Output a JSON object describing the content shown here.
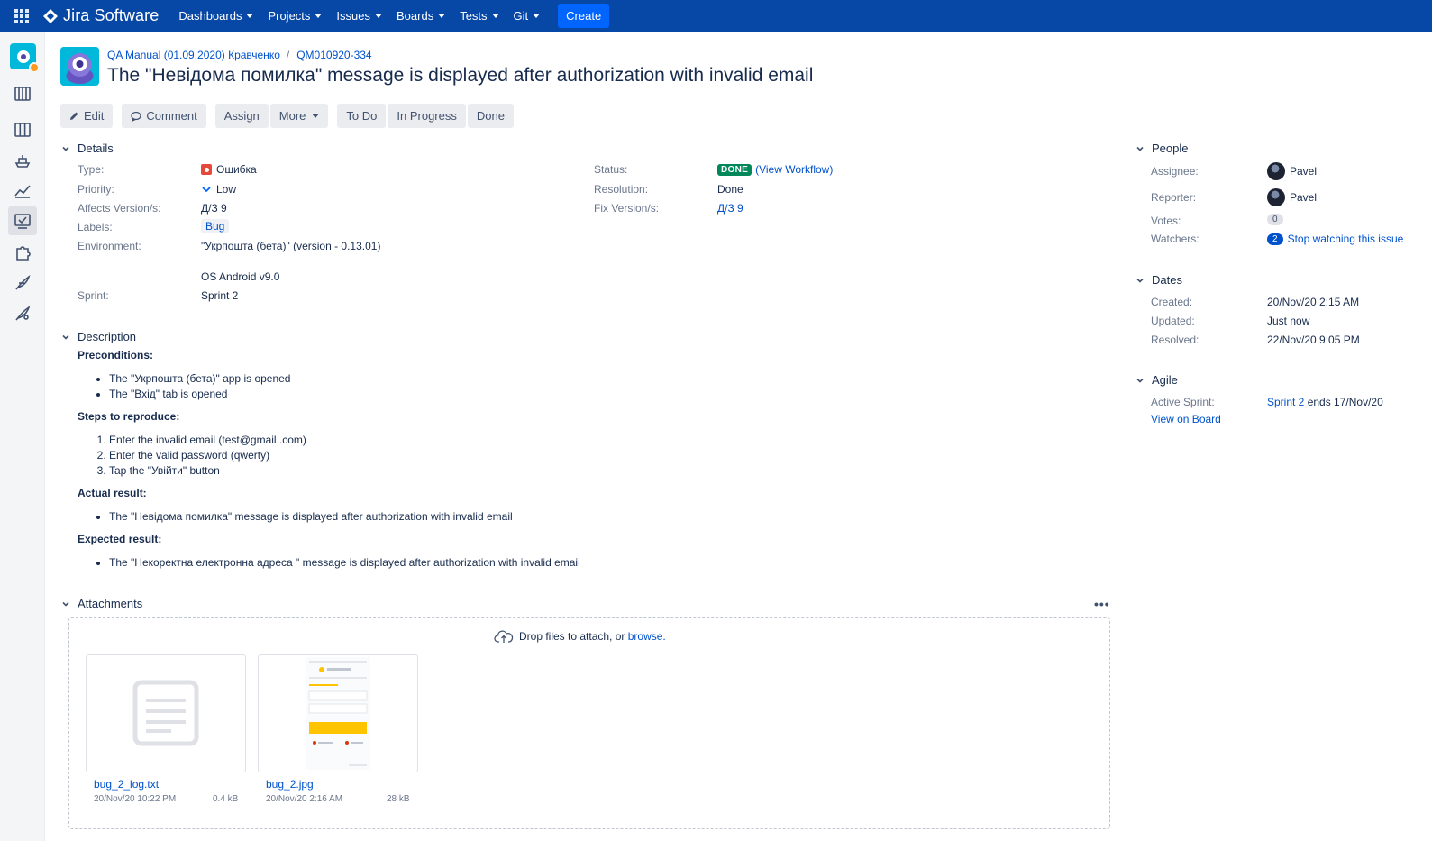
{
  "nav": {
    "product": "Jira Software",
    "items": [
      {
        "label": "Dashboards"
      },
      {
        "label": "Projects"
      },
      {
        "label": "Issues"
      },
      {
        "label": "Boards"
      },
      {
        "label": "Tests"
      },
      {
        "label": "Git"
      }
    ],
    "create": "Create"
  },
  "sidebar": {
    "icons": [
      "project-avatar",
      "backlog-icon",
      "board-icon",
      "releases-icon",
      "reports-icon",
      "issues-icon",
      "addons-icon",
      "feather-icon",
      "feather-alt-icon"
    ]
  },
  "issue": {
    "project": "QA Manual (01.09.2020) Кравченко",
    "key": "QM010920-334",
    "title": "The \"Невідома помилка\" message is displayed after authorization with invalid email"
  },
  "toolbar": {
    "edit": "Edit",
    "comment": "Comment",
    "assign": "Assign",
    "more": "More",
    "todo": "To Do",
    "in_progress": "In Progress",
    "done": "Done"
  },
  "details": {
    "heading": "Details",
    "type_label": "Type:",
    "type": "Ошибка",
    "priority_label": "Priority:",
    "priority": "Low",
    "affects_label": "Affects Version/s:",
    "affects": "Д/З 9",
    "labels_label": "Labels:",
    "label": "Bug",
    "env_label": "Environment:",
    "env_line1": "\"Укрпошта (бета)\" (version - 0.13.01)",
    "env_line2": "OS Android v9.0",
    "sprint_label": "Sprint:",
    "sprint": "Sprint 2",
    "status_label": "Status:",
    "status": "DONE",
    "workflow": "(View Workflow)",
    "resolution_label": "Resolution:",
    "resolution": "Done",
    "fix_label": "Fix Version/s:",
    "fix": "Д/З 9"
  },
  "description": {
    "heading": "Description",
    "pre_title": "Preconditions:",
    "pre": [
      "The \"Укрпошта (бета)\" app is opened",
      "The \"Вхід\" tab is opened"
    ],
    "steps_title": "Steps to reproduce:",
    "steps": [
      "Enter the invalid email (test@gmail..com)",
      "Enter the valid password (qwerty)",
      "Tap the \"Увійти\" button"
    ],
    "actual_title": "Actual result:",
    "actual": [
      "The \"Невідома помилка\" message is displayed after authorization with invalid email"
    ],
    "expected_title": "Expected result:",
    "expected": [
      "The \"Некоректна електронна адреса \" message is displayed after authorization with invalid email"
    ]
  },
  "attachments": {
    "heading": "Attachments",
    "more": "•••",
    "drop_text": "Drop files to attach, or",
    "browse": "browse.",
    "files": [
      {
        "name": "bug_2_log.txt",
        "date": "20/Nov/20 10:22 PM",
        "size": "0.4 kB"
      },
      {
        "name": "bug_2.jpg",
        "date": "20/Nov/20 2:16 AM",
        "size": "28 kB"
      }
    ]
  },
  "people": {
    "heading": "People",
    "assignee_label": "Assignee:",
    "assignee": "Pavel",
    "reporter_label": "Reporter:",
    "reporter": "Pavel",
    "votes_label": "Votes:",
    "votes": "0",
    "watchers_label": "Watchers:",
    "watchers": "2",
    "watch_link": "Stop watching this issue"
  },
  "dates": {
    "heading": "Dates",
    "created_label": "Created:",
    "created": "20/Nov/20 2:15 AM",
    "updated_label": "Updated:",
    "updated": "Just now",
    "resolved_label": "Resolved:",
    "resolved": "22/Nov/20 9:05 PM"
  },
  "agile": {
    "heading": "Agile",
    "active_label": "Active Sprint:",
    "sprint_link": "Sprint 2",
    "sprint_end": " ends 17/Nov/20",
    "view_board": "View on Board"
  },
  "colors": {
    "nav_bg": "#0747a6",
    "create_btn": "#0065ff",
    "link": "#0052cc",
    "done_lozenge": "#00875a",
    "bug_type": "#e5493a"
  }
}
